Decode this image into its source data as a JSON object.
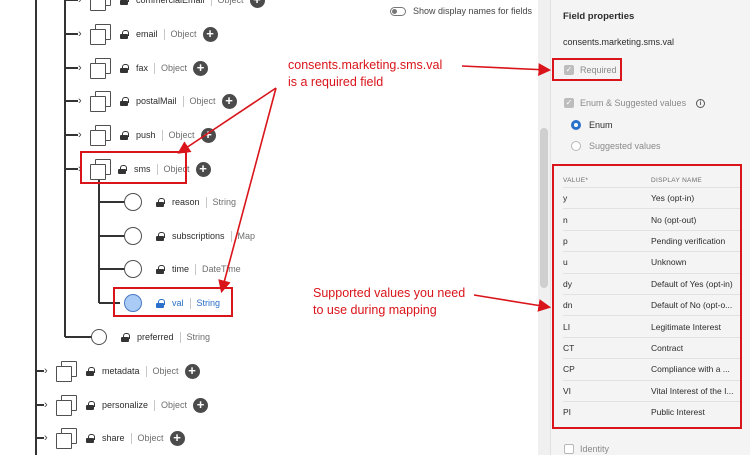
{
  "toolbar": {
    "display_names_label": "Show display names for fields"
  },
  "tree": {
    "nodes": [
      {
        "name": "commercialEmail",
        "type": "Object"
      },
      {
        "name": "email",
        "type": "Object"
      },
      {
        "name": "fax",
        "type": "Object"
      },
      {
        "name": "postalMail",
        "type": "Object"
      },
      {
        "name": "push",
        "type": "Object"
      },
      {
        "name": "sms",
        "type": "Object"
      },
      {
        "name": "reason",
        "type": "String"
      },
      {
        "name": "subscriptions",
        "type": "Map"
      },
      {
        "name": "time",
        "type": "DateTime"
      },
      {
        "name": "val",
        "type": "String"
      },
      {
        "name": "preferred",
        "type": "String"
      },
      {
        "name": "metadata",
        "type": "Object"
      },
      {
        "name": "personalize",
        "type": "Object"
      },
      {
        "name": "share",
        "type": "Object"
      }
    ]
  },
  "annotations": {
    "required_note_line1": "consents.marketing.sms.val",
    "required_note_line2": "is a required field",
    "values_note_line1": "Supported values you need",
    "values_note_line2": "to use during mapping",
    "color": "#d9141a"
  },
  "panel": {
    "title": "Field properties",
    "path": "consents.marketing.sms.val",
    "required_label": "Required",
    "enum_label": "Enum & Suggested values",
    "radio_enum": "Enum",
    "radio_suggested": "Suggested values",
    "col_value": "VALUE",
    "col_value_mark": "*",
    "col_display": "DISPLAY NAME",
    "identity_label": "Identity",
    "enum_rows": [
      {
        "value": "y",
        "display": "Yes (opt-in)"
      },
      {
        "value": "n",
        "display": "No (opt-out)"
      },
      {
        "value": "p",
        "display": "Pending verification"
      },
      {
        "value": "u",
        "display": "Unknown"
      },
      {
        "value": "dy",
        "display": "Default of Yes (opt-in)"
      },
      {
        "value": "dn",
        "display": "Default of No (opt-o..."
      },
      {
        "value": "LI",
        "display": "Legitimate Interest"
      },
      {
        "value": "CT",
        "display": "Contract"
      },
      {
        "value": "CP",
        "display": "Compliance with a ..."
      },
      {
        "value": "VI",
        "display": "Vital Interest of the I..."
      },
      {
        "value": "PI",
        "display": "Public Interest"
      }
    ]
  },
  "colors": {
    "accent": "#2a6fc9",
    "selected_node": "#a9cbf5"
  }
}
